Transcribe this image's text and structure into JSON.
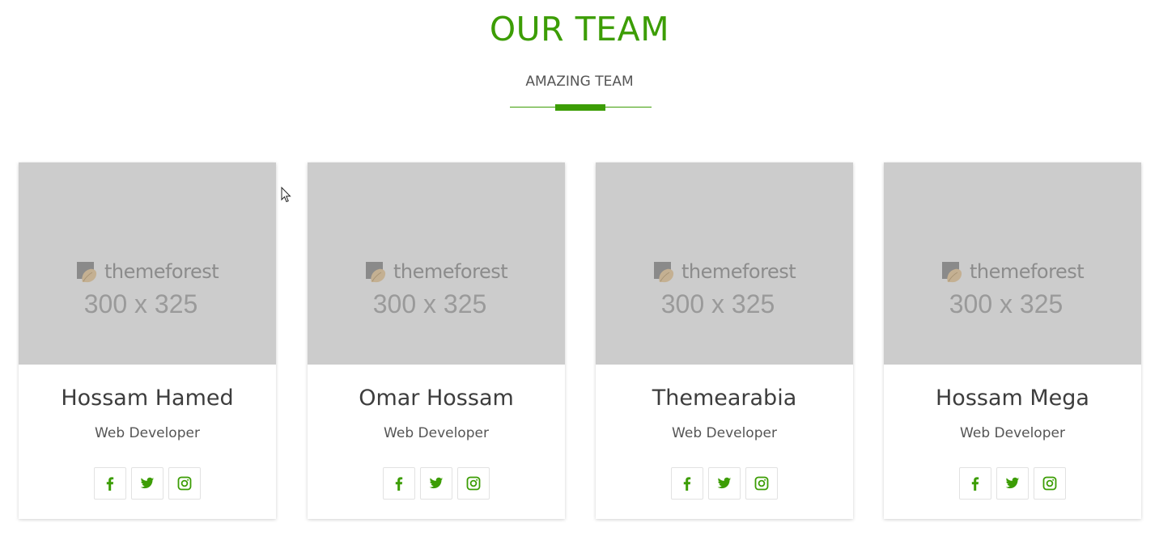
{
  "section": {
    "title": "OUR TEAM",
    "subtitle": "AMAZING TEAM"
  },
  "colors": {
    "accent": "#3c9d05",
    "placeholder_bg": "#cccccc",
    "text_dark": "#3d3d3d",
    "text_muted": "#555555"
  },
  "placeholder": {
    "logo_text": "themeforest",
    "dimensions": "300 x 325"
  },
  "team": [
    {
      "name": "Hossam Hamed",
      "role": "Web Developer"
    },
    {
      "name": "Omar Hossam",
      "role": "Web Developer"
    },
    {
      "name": "Themearabia",
      "role": "Web Developer"
    },
    {
      "name": "Hossam Mega",
      "role": "Web Developer"
    }
  ],
  "social_icons": [
    "facebook-icon",
    "twitter-icon",
    "instagram-icon"
  ]
}
